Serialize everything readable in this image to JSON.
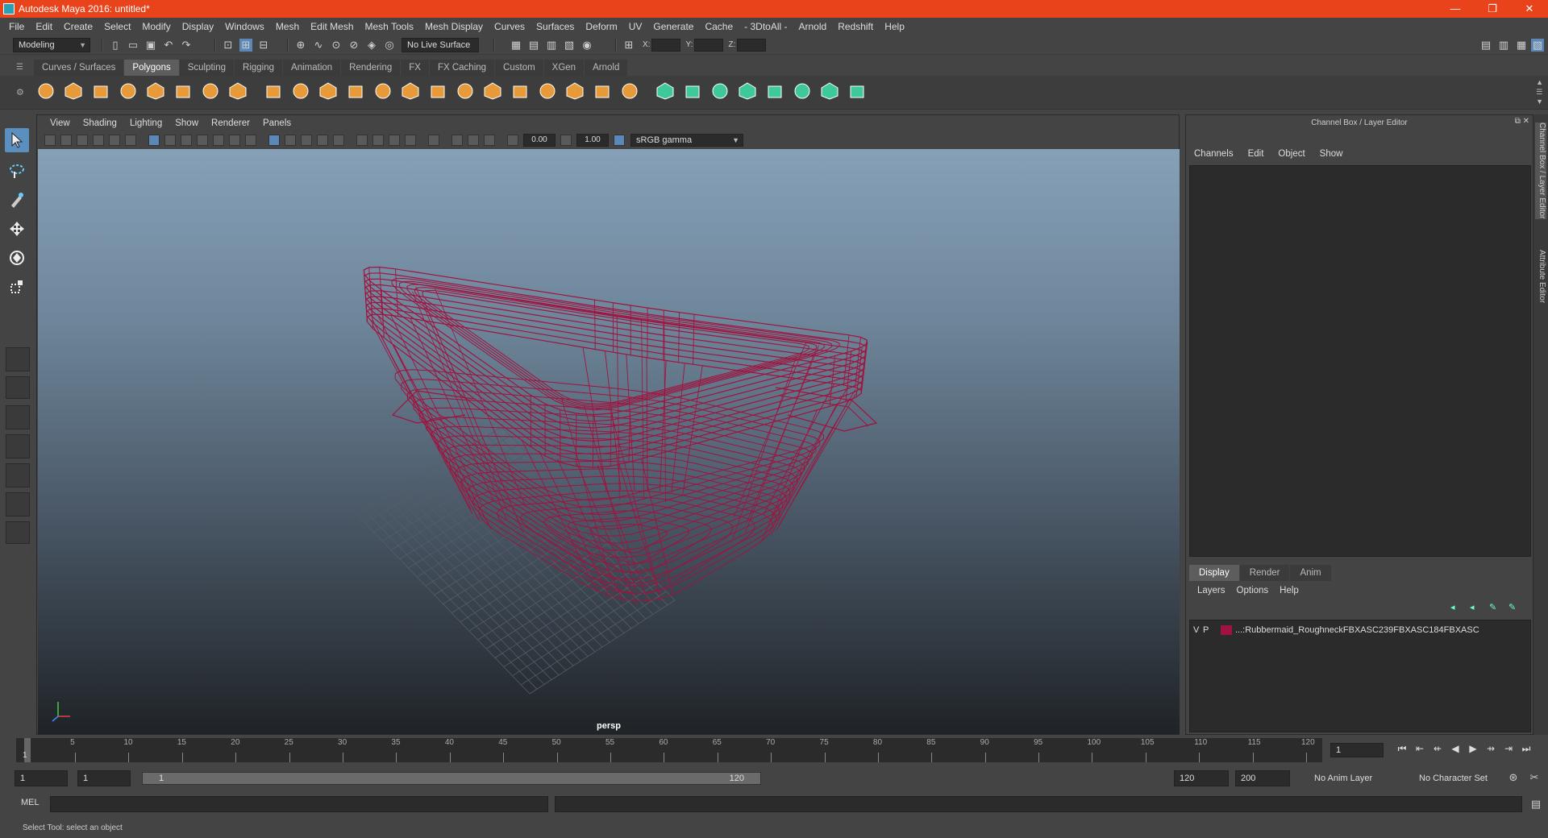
{
  "window": {
    "title": "Autodesk Maya 2016: untitled*",
    "minimize": "—",
    "restore": "❐",
    "close": "✕"
  },
  "menubar": [
    "File",
    "Edit",
    "Create",
    "Select",
    "Modify",
    "Display",
    "Windows",
    "Mesh",
    "Edit Mesh",
    "Mesh Tools",
    "Mesh Display",
    "Curves",
    "Surfaces",
    "Deform",
    "UV",
    "Generate",
    "Cache",
    "- 3DtoAll -",
    "Arnold",
    "Redshift",
    "Help"
  ],
  "statusline": {
    "mode": "Modeling",
    "live_surface": "No Live Surface",
    "x_label": "X:",
    "y_label": "Y:",
    "z_label": "Z:"
  },
  "shelf": {
    "tabs": [
      "Curves / Surfaces",
      "Polygons",
      "Sculpting",
      "Rigging",
      "Animation",
      "Rendering",
      "FX",
      "FX Caching",
      "Custom",
      "XGen",
      "Arnold"
    ],
    "active_tab": "Polygons",
    "icons": [
      "poly-sphere-icon",
      "poly-cube-icon",
      "poly-cylinder-icon",
      "poly-cone-icon",
      "poly-plane-icon",
      "poly-torus-icon",
      "poly-pyramid-icon",
      "poly-pipe-icon",
      "combine-icon",
      "separate-icon",
      "extract-icon",
      "smooth-icon",
      "booleans-icon",
      "mirror-icon",
      "bevel-icon",
      "multi-cut-icon",
      "bridge-icon",
      "extrude-icon",
      "append-icon",
      "fill-hole-icon",
      "merge-icon",
      "collapse-icon",
      "target-weld-icon",
      "uv-planar-icon",
      "uv-auto-icon",
      "uv-cylindrical-icon",
      "uv-spherical-icon",
      "uv-editor-icon",
      "checker-icon",
      "sew-uv-icon"
    ]
  },
  "viewport": {
    "menu": [
      "View",
      "Shading",
      "Lighting",
      "Show",
      "Renderer",
      "Panels"
    ],
    "exposure": "0.00",
    "gamma_value": "1.00",
    "color_space": "sRGB gamma",
    "camera": "persp",
    "wire_color": "#a0133e"
  },
  "channelbox": {
    "title": "Channel Box / Layer Editor",
    "menu": [
      "Channels",
      "Edit",
      "Object",
      "Show"
    ],
    "layer_tabs": [
      "Display",
      "Render",
      "Anim"
    ],
    "layer_menu": [
      "Layers",
      "Options",
      "Help"
    ],
    "layer": {
      "v": "V",
      "p": "P",
      "name": "...:Rubbermaid_RoughneckFBXASC239FBXASC184FBXASC",
      "color": "#a0133e"
    },
    "side_tabs": [
      "Channel Box / Layer Editor",
      "Attribute Editor"
    ]
  },
  "timeslider": {
    "ticks": [
      "5",
      "10",
      "15",
      "20",
      "25",
      "30",
      "35",
      "40",
      "45",
      "50",
      "55",
      "60",
      "65",
      "70",
      "75",
      "80",
      "85",
      "90",
      "95",
      "100",
      "105",
      "110",
      "115",
      "120"
    ],
    "start_tick": "1",
    "current_frame": "1"
  },
  "rangeslider": {
    "start": "1",
    "playback_start": "1",
    "bar_start": "1",
    "bar_end": "120",
    "playback_end": "120",
    "end": "200",
    "anim_layer": "No Anim Layer",
    "character_set": "No Character Set"
  },
  "cmdline": {
    "label": "MEL"
  },
  "helpline": {
    "text": "Select Tool: select an object"
  }
}
